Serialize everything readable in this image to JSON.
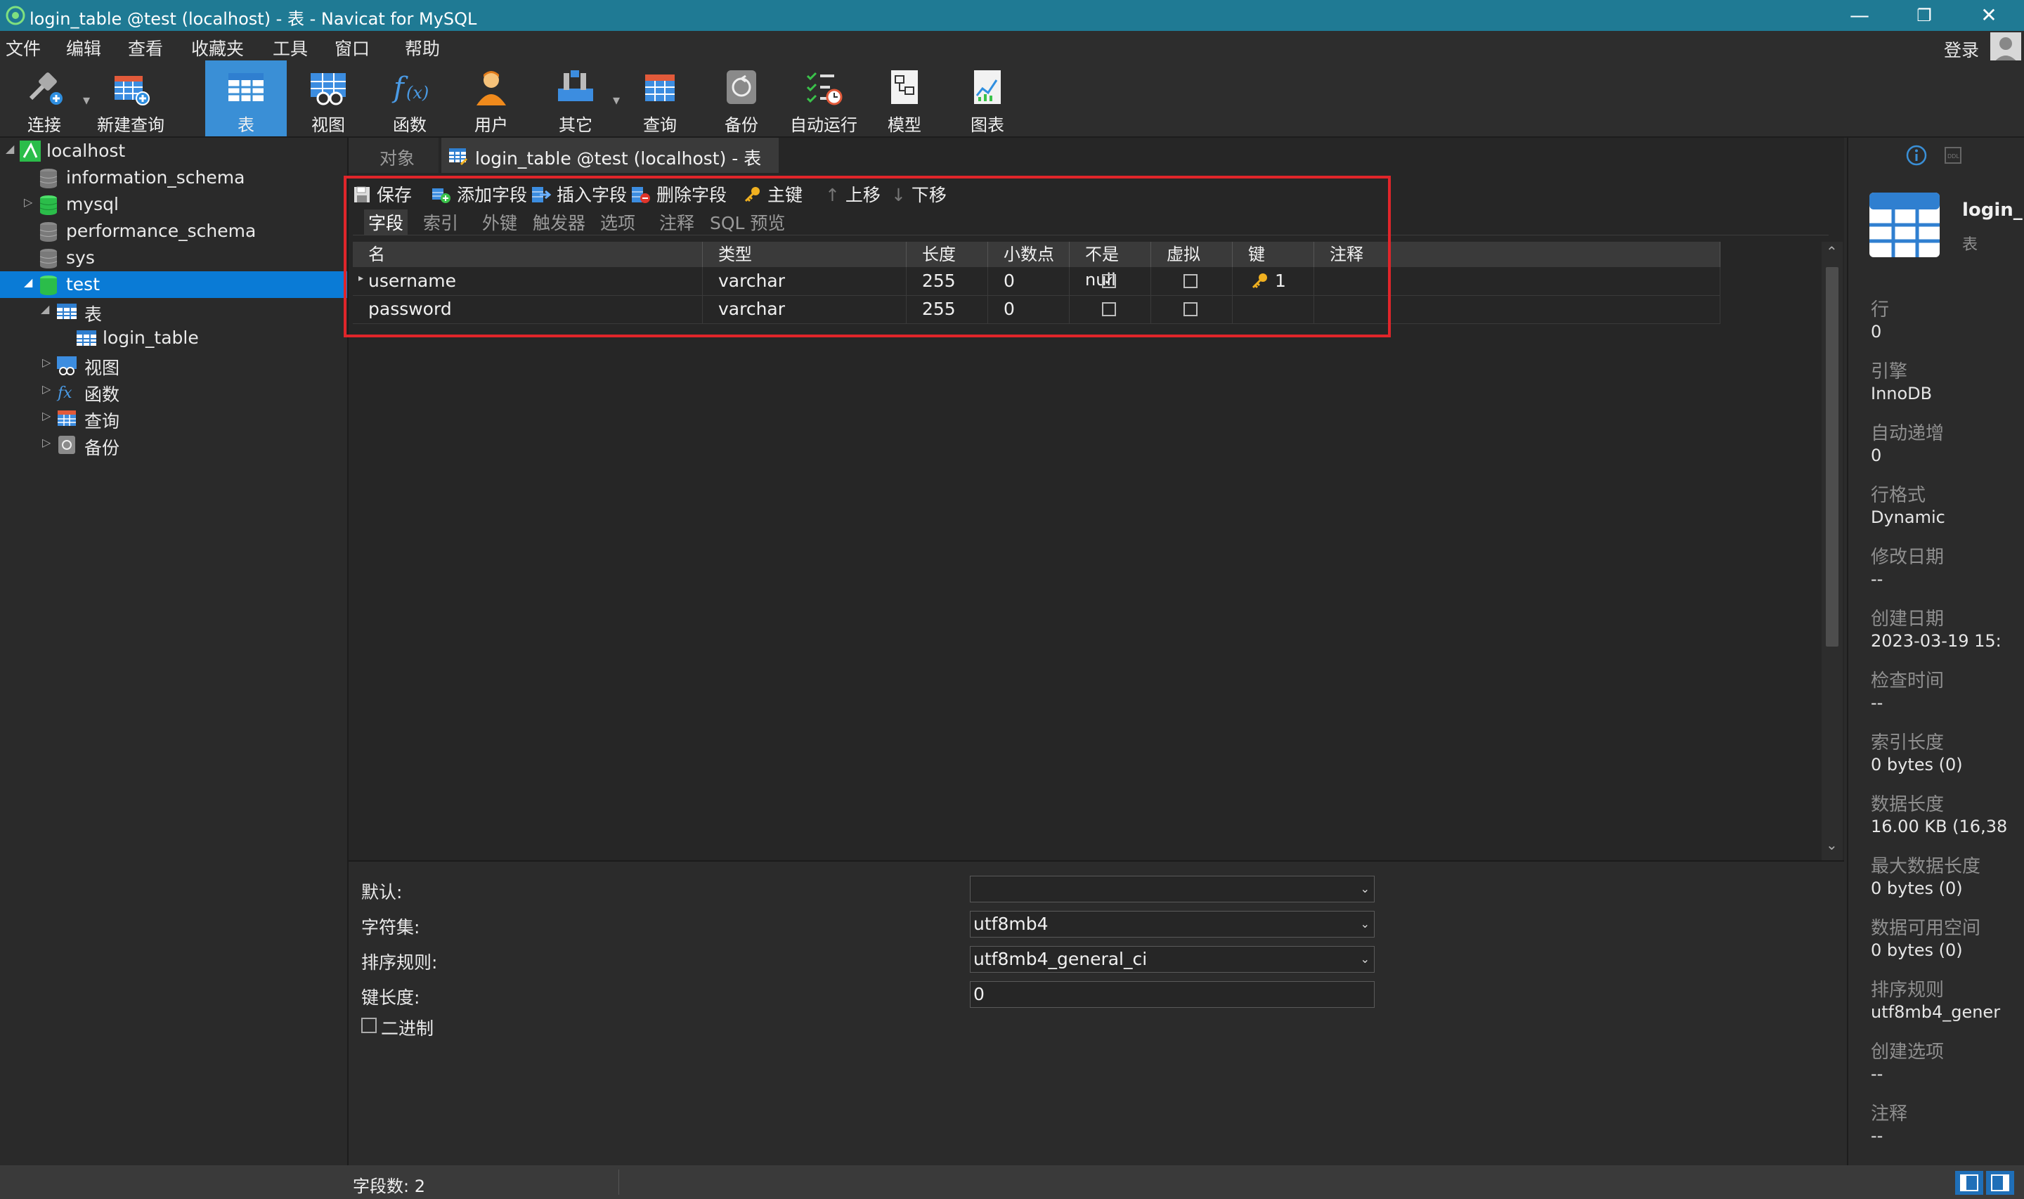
{
  "window": {
    "title": "login_table @test (localhost) - 表 - Navicat for MySQL",
    "minimize": "—",
    "restore": "❐",
    "close": "✕"
  },
  "menu": [
    "文件",
    "编辑",
    "查看",
    "收藏夹",
    "工具",
    "窗口",
    "帮助"
  ],
  "login_label": "登录",
  "toolbar": [
    {
      "label": "连接",
      "icon": "connect-icon"
    },
    {
      "label": "新建查询",
      "icon": "new-query-icon"
    },
    {
      "label": "表",
      "icon": "table-icon"
    },
    {
      "label": "视图",
      "icon": "view-icon"
    },
    {
      "label": "函数",
      "icon": "function-icon"
    },
    {
      "label": "用户",
      "icon": "user-icon"
    },
    {
      "label": "其它",
      "icon": "other-icon"
    },
    {
      "label": "查询",
      "icon": "query-icon"
    },
    {
      "label": "备份",
      "icon": "backup-icon"
    },
    {
      "label": "自动运行",
      "icon": "auto-run-icon"
    },
    {
      "label": "模型",
      "icon": "model-icon"
    },
    {
      "label": "图表",
      "icon": "chart-icon"
    }
  ],
  "tree": [
    {
      "label": "localhost"
    },
    {
      "label": "information_schema"
    },
    {
      "label": "mysql"
    },
    {
      "label": "performance_schema"
    },
    {
      "label": "sys"
    },
    {
      "label": "test"
    },
    {
      "label": "表"
    },
    {
      "label": "login_table"
    },
    {
      "label": "视图"
    },
    {
      "label": "函数"
    },
    {
      "label": "查询"
    },
    {
      "label": "备份"
    }
  ],
  "tabs": {
    "objects": "对象",
    "active": "login_table @test (localhost) - 表"
  },
  "editor_toolbar": {
    "save": "保存",
    "add_field": "添加字段",
    "insert_field": "插入字段",
    "delete_field": "删除字段",
    "primary_key": "主键",
    "move_up": "上移",
    "move_down": "下移"
  },
  "subtabs": [
    "字段",
    "索引",
    "外键",
    "触发器",
    "选项",
    "注释",
    "SQL 预览"
  ],
  "columns": [
    "名",
    "类型",
    "长度",
    "小数点",
    "不是 null",
    "虚拟",
    "键",
    "注释"
  ],
  "rows": [
    {
      "name": "username",
      "type": "varchar",
      "length": "255",
      "decimals": "0",
      "not_null": true,
      "virtual": false,
      "key": "1",
      "comment": ""
    },
    {
      "name": "password",
      "type": "varchar",
      "length": "255",
      "decimals": "0",
      "not_null": false,
      "virtual": false,
      "key": "",
      "comment": ""
    }
  ],
  "properties": {
    "default_label": "默认:",
    "default_value": "",
    "charset_label": "字符集:",
    "charset_value": "utf8mb4",
    "collation_label": "排序规则:",
    "collation_value": "utf8mb4_general_ci",
    "keylen_label": "键长度:",
    "keylen_value": "0",
    "binary_label": "二进制"
  },
  "info_panel": {
    "object_name": "login_",
    "object_type": "表",
    "items": [
      {
        "label": "行",
        "value": "0"
      },
      {
        "label": "引擎",
        "value": "InnoDB"
      },
      {
        "label": "自动递增",
        "value": "0"
      },
      {
        "label": "行格式",
        "value": "Dynamic"
      },
      {
        "label": "修改日期",
        "value": "--"
      },
      {
        "label": "创建日期",
        "value": "2023-03-19 15:"
      },
      {
        "label": "检查时间",
        "value": "--"
      },
      {
        "label": "索引长度",
        "value": "0 bytes (0)"
      },
      {
        "label": "数据长度",
        "value": "16.00 KB (16,38"
      },
      {
        "label": "最大数据长度",
        "value": "0 bytes (0)"
      },
      {
        "label": "数据可用空间",
        "value": "0 bytes (0)"
      },
      {
        "label": "排序规则",
        "value": "utf8mb4_gener"
      },
      {
        "label": "创建选项",
        "value": "--"
      },
      {
        "label": "注释",
        "value": "--"
      }
    ]
  },
  "status": {
    "field_count": "字段数: 2"
  },
  "colors": {
    "titlebar": "#1f7a94",
    "selection": "#0a7bd6",
    "active_tool": "#3a8fd6",
    "highlight_box": "#e0252a"
  }
}
